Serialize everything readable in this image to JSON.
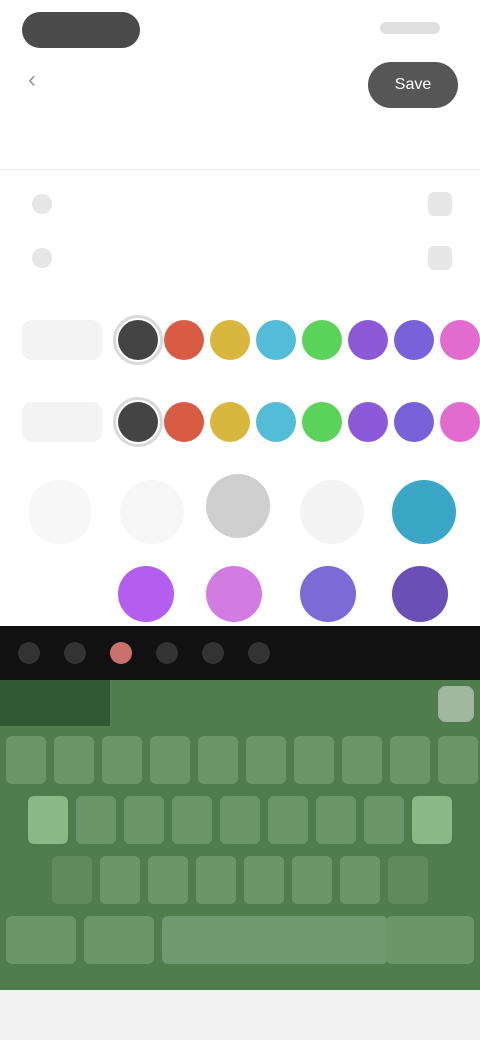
{
  "header": {
    "title": "",
    "save_label": "Save"
  },
  "tab": {
    "label": ""
  },
  "inputs": [
    {
      "value": "",
      "placeholder": ""
    },
    {
      "value": "",
      "placeholder": ""
    }
  ],
  "colors": {
    "row1": [
      "#444444",
      "#d85b44",
      "#d9b63d",
      "#53bcd6",
      "#5bd35a",
      "#8c59d8",
      "#7762d9",
      "#e26bd0"
    ],
    "row2": [
      "#444444",
      "#d85b44",
      "#d9b63d",
      "#53bcd6",
      "#5bd35a",
      "#8c59d8",
      "#7762d9",
      "#e26bd0"
    ]
  },
  "stickers": [
    {
      "name": "circle-1",
      "color": "#f7f7f7"
    },
    {
      "name": "circle-2",
      "color": "#f7f7f7"
    },
    {
      "name": "circle-3",
      "color": "#cfcfcf"
    },
    {
      "name": "circle-4",
      "color": "#f3f3f3"
    },
    {
      "name": "circle-5",
      "color": "#3aa7c6"
    },
    {
      "name": "blob-1",
      "color": "#b45ef0"
    },
    {
      "name": "blob-2",
      "color": "#d27be0"
    },
    {
      "name": "blob-3",
      "color": "#7c6bd6"
    },
    {
      "name": "blob-4",
      "color": "#6b4fb7"
    }
  ],
  "keyboard": {
    "rows": [
      [
        "",
        "",
        "",
        "",
        "",
        "",
        "",
        "",
        "",
        ""
      ],
      [
        "",
        "",
        "",
        "",
        "",
        "",
        "",
        "",
        ""
      ],
      [
        "",
        "",
        "",
        "",
        "",
        "",
        "",
        ""
      ],
      [
        "",
        "",
        "",
        ""
      ]
    ]
  }
}
